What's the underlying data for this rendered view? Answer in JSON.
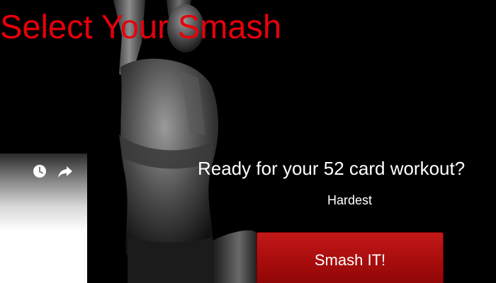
{
  "header": {
    "title": "Select Your Smash"
  },
  "video_card": {
    "icons": [
      "clock-icon",
      "share-icon"
    ]
  },
  "main": {
    "prompt": "Ready for your 52 card workout?",
    "difficulty": "Hardest",
    "smash_button_label": "Smash IT!"
  },
  "colors": {
    "title_red": "#e8000b",
    "button_red": "#b31010",
    "background": "#000000"
  }
}
